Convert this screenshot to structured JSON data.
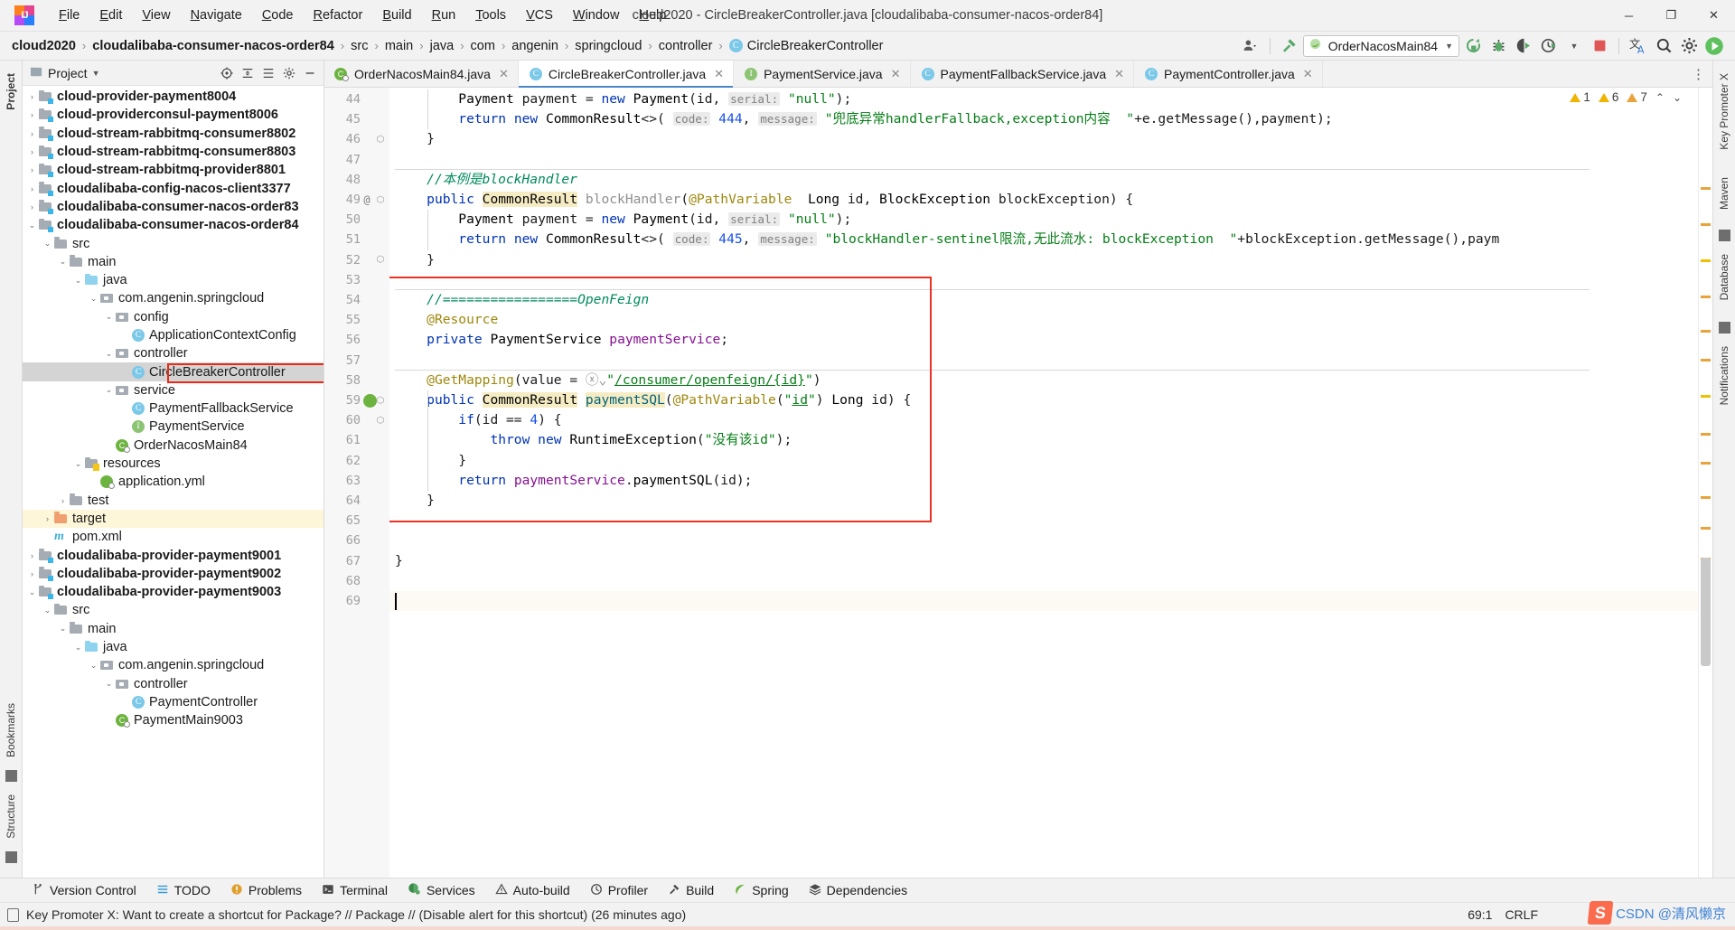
{
  "window": {
    "title": "cloud2020 - CircleBreakerController.java [cloudalibaba-consumer-nacos-order84]",
    "minimize": "─",
    "maximize": "❐",
    "close": "✕"
  },
  "menu": [
    {
      "label": "File"
    },
    {
      "label": "Edit"
    },
    {
      "label": "View"
    },
    {
      "label": "Navigate"
    },
    {
      "label": "Code"
    },
    {
      "label": "Refactor"
    },
    {
      "label": "Build"
    },
    {
      "label": "Run"
    },
    {
      "label": "Tools"
    },
    {
      "label": "VCS"
    },
    {
      "label": "Window"
    },
    {
      "label": "Help"
    }
  ],
  "breadcrumb": [
    {
      "label": "cloud2020",
      "bold": true
    },
    {
      "label": "cloudalibaba-consumer-nacos-order84",
      "bold": true
    },
    {
      "label": "src",
      "bold": false
    },
    {
      "label": "main",
      "bold": false
    },
    {
      "label": "java",
      "bold": false
    },
    {
      "label": "com",
      "bold": false
    },
    {
      "label": "angenin",
      "bold": false
    },
    {
      "label": "springcloud",
      "bold": false
    },
    {
      "label": "controller",
      "bold": false
    },
    {
      "label": "CircleBreakerController",
      "bold": false,
      "icon": "class-icon",
      "badge": "C"
    }
  ],
  "toolbar": {
    "run_config": "OrderNacosMain84",
    "icons": [
      {
        "name": "profile-icon",
        "glyph": "👤"
      },
      {
        "name": "hammer-build-icon",
        "glyph": "⚒"
      },
      {
        "name": "rerun-icon",
        "glyph": "⟳"
      },
      {
        "name": "debug-icon",
        "glyph": "🐞"
      },
      {
        "name": "run-with-coverage-icon",
        "glyph": "▶"
      },
      {
        "name": "profiler-run-icon",
        "glyph": "⏱"
      },
      {
        "name": "stop-icon",
        "glyph": "■"
      },
      {
        "name": "translate-icon",
        "glyph": "文A"
      },
      {
        "name": "search-everywhere-icon",
        "glyph": "🔍"
      },
      {
        "name": "settings-gear-icon",
        "glyph": "⚙"
      },
      {
        "name": "play-green-icon",
        "glyph": "▶"
      }
    ]
  },
  "left_strip": [
    {
      "label": "Project",
      "selected": true
    },
    {
      "label": "Bookmarks",
      "selected": false
    },
    {
      "label": "Structure",
      "selected": false
    }
  ],
  "right_strip": [
    {
      "label": "Key Promoter X"
    },
    {
      "label": "Maven"
    },
    {
      "label": "Database"
    },
    {
      "label": "Notifications"
    }
  ],
  "project_panel": {
    "title": "Project",
    "caret": "▾",
    "actions": [
      {
        "name": "select-opened-file-icon",
        "glyph": "⊕"
      },
      {
        "name": "expand-all-icon",
        "glyph": "≡"
      },
      {
        "name": "collapse-all-icon",
        "glyph": "≣"
      },
      {
        "name": "settings-gear-icon",
        "glyph": "⚙"
      },
      {
        "name": "hide-panel-icon",
        "glyph": "─"
      }
    ],
    "tree": [
      {
        "label": "cloud-provider-payment8004",
        "indent": 1,
        "arrow": "›",
        "icon": "module",
        "bold": true
      },
      {
        "label": "cloud-providerconsul-payment8006",
        "indent": 1,
        "arrow": "›",
        "icon": "module",
        "bold": true
      },
      {
        "label": "cloud-stream-rabbitmq-consumer8802",
        "indent": 1,
        "arrow": "›",
        "icon": "module",
        "bold": true
      },
      {
        "label": "cloud-stream-rabbitmq-consumer8803",
        "indent": 1,
        "arrow": "›",
        "icon": "module",
        "bold": true
      },
      {
        "label": "cloud-stream-rabbitmq-provider8801",
        "indent": 1,
        "arrow": "›",
        "icon": "module",
        "bold": true
      },
      {
        "label": "cloudalibaba-config-nacos-client3377",
        "indent": 1,
        "arrow": "›",
        "icon": "module",
        "bold": true
      },
      {
        "label": "cloudalibaba-consumer-nacos-order83",
        "indent": 1,
        "arrow": "›",
        "icon": "module",
        "bold": true
      },
      {
        "label": "cloudalibaba-consumer-nacos-order84",
        "indent": 1,
        "arrow": "⌄",
        "icon": "module",
        "bold": true
      },
      {
        "label": "src",
        "indent": 2,
        "arrow": "⌄",
        "icon": "folder"
      },
      {
        "label": "main",
        "indent": 3,
        "arrow": "⌄",
        "icon": "folder"
      },
      {
        "label": "java",
        "indent": 4,
        "arrow": "⌄",
        "icon": "source"
      },
      {
        "label": "com.angenin.springcloud",
        "indent": 5,
        "arrow": "⌄",
        "icon": "package"
      },
      {
        "label": "config",
        "indent": 6,
        "arrow": "⌄",
        "icon": "package"
      },
      {
        "label": "ApplicationContextConfig",
        "indent": 7,
        "arrow": "",
        "icon": "class"
      },
      {
        "label": "controller",
        "indent": 6,
        "arrow": "⌄",
        "icon": "package"
      },
      {
        "label": "CircleBreakerController",
        "indent": 7,
        "arrow": "",
        "icon": "class",
        "selected": true,
        "outlined": true
      },
      {
        "label": "service",
        "indent": 6,
        "arrow": "⌄",
        "icon": "package"
      },
      {
        "label": "PaymentFallbackService",
        "indent": 7,
        "arrow": "",
        "icon": "class"
      },
      {
        "label": "PaymentService",
        "indent": 7,
        "arrow": "",
        "icon": "interface"
      },
      {
        "label": "OrderNacosMain84",
        "indent": 6,
        "arrow": "",
        "icon": "spring"
      },
      {
        "label": "resources",
        "indent": 4,
        "arrow": "⌄",
        "icon": "resources"
      },
      {
        "label": "application.yml",
        "indent": 5,
        "arrow": "",
        "icon": "yml"
      },
      {
        "label": "test",
        "indent": 3,
        "arrow": "›",
        "icon": "folder"
      },
      {
        "label": "target",
        "indent": 2,
        "arrow": "›",
        "icon": "target",
        "highlight": true
      },
      {
        "label": "pom.xml",
        "indent": 2,
        "arrow": "",
        "icon": "maven"
      },
      {
        "label": "cloudalibaba-provider-payment9001",
        "indent": 1,
        "arrow": "›",
        "icon": "module",
        "bold": true
      },
      {
        "label": "cloudalibaba-provider-payment9002",
        "indent": 1,
        "arrow": "›",
        "icon": "module",
        "bold": true
      },
      {
        "label": "cloudalibaba-provider-payment9003",
        "indent": 1,
        "arrow": "⌄",
        "icon": "module",
        "bold": true
      },
      {
        "label": "src",
        "indent": 2,
        "arrow": "⌄",
        "icon": "folder"
      },
      {
        "label": "main",
        "indent": 3,
        "arrow": "⌄",
        "icon": "folder"
      },
      {
        "label": "java",
        "indent": 4,
        "arrow": "⌄",
        "icon": "source"
      },
      {
        "label": "com.angenin.springcloud",
        "indent": 5,
        "arrow": "⌄",
        "icon": "package"
      },
      {
        "label": "controller",
        "indent": 6,
        "arrow": "⌄",
        "icon": "package"
      },
      {
        "label": "PaymentController",
        "indent": 7,
        "arrow": "",
        "icon": "class"
      },
      {
        "label": "PaymentMain9003",
        "indent": 6,
        "arrow": "",
        "icon": "spring"
      }
    ]
  },
  "editor_tabs": [
    {
      "label": "OrderNacosMain84.java",
      "icon": "spring-class-icon",
      "active": false,
      "close": "✕"
    },
    {
      "label": "CircleBreakerController.java",
      "icon": "class-icon",
      "active": true,
      "close": "✕"
    },
    {
      "label": "PaymentService.java",
      "icon": "interface-icon",
      "active": false,
      "close": "✕"
    },
    {
      "label": "PaymentFallbackService.java",
      "icon": "class-icon",
      "active": false,
      "close": "✕"
    },
    {
      "label": "PaymentController.java",
      "icon": "class-icon",
      "active": false,
      "close": "✕"
    }
  ],
  "inspection": {
    "warnings_yellow": "1",
    "warnings_weak": "6",
    "warnings_other": "7",
    "up_arrow": "⌃",
    "down_arrow": "⌄"
  },
  "code": {
    "first_line": 44,
    "cursor_line": 69,
    "lines": [
      {
        "no": 44,
        "at": "",
        "fold": "",
        "html": "        <span class=\"ty\">Payment</span> payment = <span class=\"k\">new</span> <span class=\"ty\">Payment</span>(id, <span class=\"hint\">serial:</span> <span class=\"s\">\"null\"</span>);"
      },
      {
        "no": 45,
        "at": "",
        "fold": "",
        "html": "        <span class=\"k\">return</span> <span class=\"k\">new</span> <span class=\"ty\">CommonResult</span>&lt;&gt;( <span class=\"hint\">code:</span> <span class=\"n\">444</span>, <span class=\"hint\">message:</span> <span class=\"s\">\"兜底异常handlerFallback,exception内容  \"</span>+e.getMessage(),payment);"
      },
      {
        "no": 46,
        "at": "",
        "fold": "⬡",
        "html": "    }"
      },
      {
        "no": 47,
        "at": "",
        "fold": "",
        "html": ""
      },
      {
        "no": 48,
        "at": "",
        "fold": "",
        "html": "    <span class=\"cz\">//本例是blockHandler</span>"
      },
      {
        "no": 49,
        "at": "@",
        "fold": "⬡",
        "html": "    <span class=\"k\">public</span> <span class=\"ty hi\">CommonResult</span> <span class=\"gry\">blockHandler</span>(<span class=\"an\">@PathVariable</span>  <span class=\"ty\">Long</span> id, <span class=\"ty\">BlockException</span> blockException) {"
      },
      {
        "no": 50,
        "at": "",
        "fold": "",
        "html": "        <span class=\"ty\">Payment</span> payment = <span class=\"k\">new</span> <span class=\"ty\">Payment</span>(id, <span class=\"hint\">serial:</span> <span class=\"s\">\"null\"</span>);"
      },
      {
        "no": 51,
        "at": "",
        "fold": "",
        "html": "        <span class=\"k\">return</span> <span class=\"k\">new</span> <span class=\"ty\">CommonResult</span>&lt;&gt;( <span class=\"hint\">code:</span> <span class=\"n\">445</span>, <span class=\"hint\">message:</span> <span class=\"s\">\"blockHandler-sentinel限流,无此流水: blockException  \"</span>+blockException.getMessage(),paym"
      },
      {
        "no": 52,
        "at": "",
        "fold": "⬡",
        "html": "    }"
      },
      {
        "no": 53,
        "at": "",
        "fold": "",
        "html": ""
      },
      {
        "no": 54,
        "at": "",
        "fold": "",
        "html": "    <span class=\"cz\">//=================OpenFeign</span>"
      },
      {
        "no": 55,
        "at": "",
        "fold": "",
        "html": "    <span class=\"an\">@Resource</span>"
      },
      {
        "no": 56,
        "at": "",
        "fold": "",
        "html": "    <span class=\"k\">private</span> <span class=\"ty\">PaymentService</span> <span class=\"fd\">paymentService</span>;"
      },
      {
        "no": 57,
        "at": "",
        "fold": "",
        "html": ""
      },
      {
        "no": 58,
        "at": "",
        "fold": "",
        "html": "    <span class=\"an\">@GetMapping</span>(value = <span class=\"gry\">ⓧ⌄</span><span class=\"s\">\"</span><span class=\"lnk\">/consumer/openfeign/{id}</span><span class=\"s\">\"</span>)"
      },
      {
        "no": 59,
        "at": "",
        "fold": "⬡",
        "html": "    <span class=\"k\">public</span> <span class=\"ty hi\">CommonResult</span> <span class=\"mth hi\">paymentSQL</span>(<span class=\"an\">@PathVariable</span>(<span class=\"s\">\"</span><span class=\"lnk\">id</span><span class=\"s\">\"</span>) <span class=\"ty\">Long</span> id) {"
      },
      {
        "no": 60,
        "at": "",
        "fold": "⬡",
        "html": "        <span class=\"k\">if</span>(id == <span class=\"n\">4</span>) {"
      },
      {
        "no": 61,
        "at": "",
        "fold": "",
        "html": "            <span class=\"k\">throw</span> <span class=\"k\">new</span> <span class=\"ty\">RuntimeException</span>(<span class=\"s\">\"没有该id\"</span>);"
      },
      {
        "no": 62,
        "at": "",
        "fold": "",
        "html": "        }"
      },
      {
        "no": 63,
        "at": "",
        "fold": "",
        "html": "        <span class=\"k\">return</span> <span class=\"fd\">paymentService</span>.<span class=\"ty\">paymentSQL</span>(id);"
      },
      {
        "no": 64,
        "at": "",
        "fold": "",
        "html": "    }"
      },
      {
        "no": 65,
        "at": "",
        "fold": "",
        "html": ""
      },
      {
        "no": 66,
        "at": "",
        "fold": "",
        "html": ""
      },
      {
        "no": 67,
        "at": "",
        "fold": "",
        "html": "}"
      },
      {
        "no": 68,
        "at": "",
        "fold": "",
        "html": ""
      },
      {
        "no": 69,
        "at": "",
        "fold": "",
        "html": ""
      }
    ]
  },
  "tool_windows": [
    {
      "label": "Version Control",
      "icon": "branch-icon",
      "glyph": "⑂"
    },
    {
      "label": "TODO",
      "icon": "todo-icon",
      "glyph": "≡"
    },
    {
      "label": "Problems",
      "icon": "problems-icon",
      "glyph": "❗"
    },
    {
      "label": "Terminal",
      "icon": "terminal-icon",
      "glyph": "⬛"
    },
    {
      "label": "Services",
      "icon": "services-icon",
      "glyph": "◐"
    },
    {
      "label": "Auto-build",
      "icon": "warning-icon",
      "glyph": "⚠"
    },
    {
      "label": "Profiler",
      "icon": "profiler-icon",
      "glyph": "◴"
    },
    {
      "label": "Build",
      "icon": "hammer-icon",
      "glyph": "⚒"
    },
    {
      "label": "Spring",
      "icon": "spring-leaf-icon",
      "glyph": "🍃"
    },
    {
      "label": "Dependencies",
      "icon": "layers-icon",
      "glyph": "≣"
    }
  ],
  "status": {
    "message": "Key Promoter X: Want to create a shortcut for Package? // Package // (Disable alert for this shortcut) (26 minutes ago)",
    "caret_position": "69:1",
    "line_separator": "CRLF",
    "watermark": "CSDN @清风懒京"
  }
}
